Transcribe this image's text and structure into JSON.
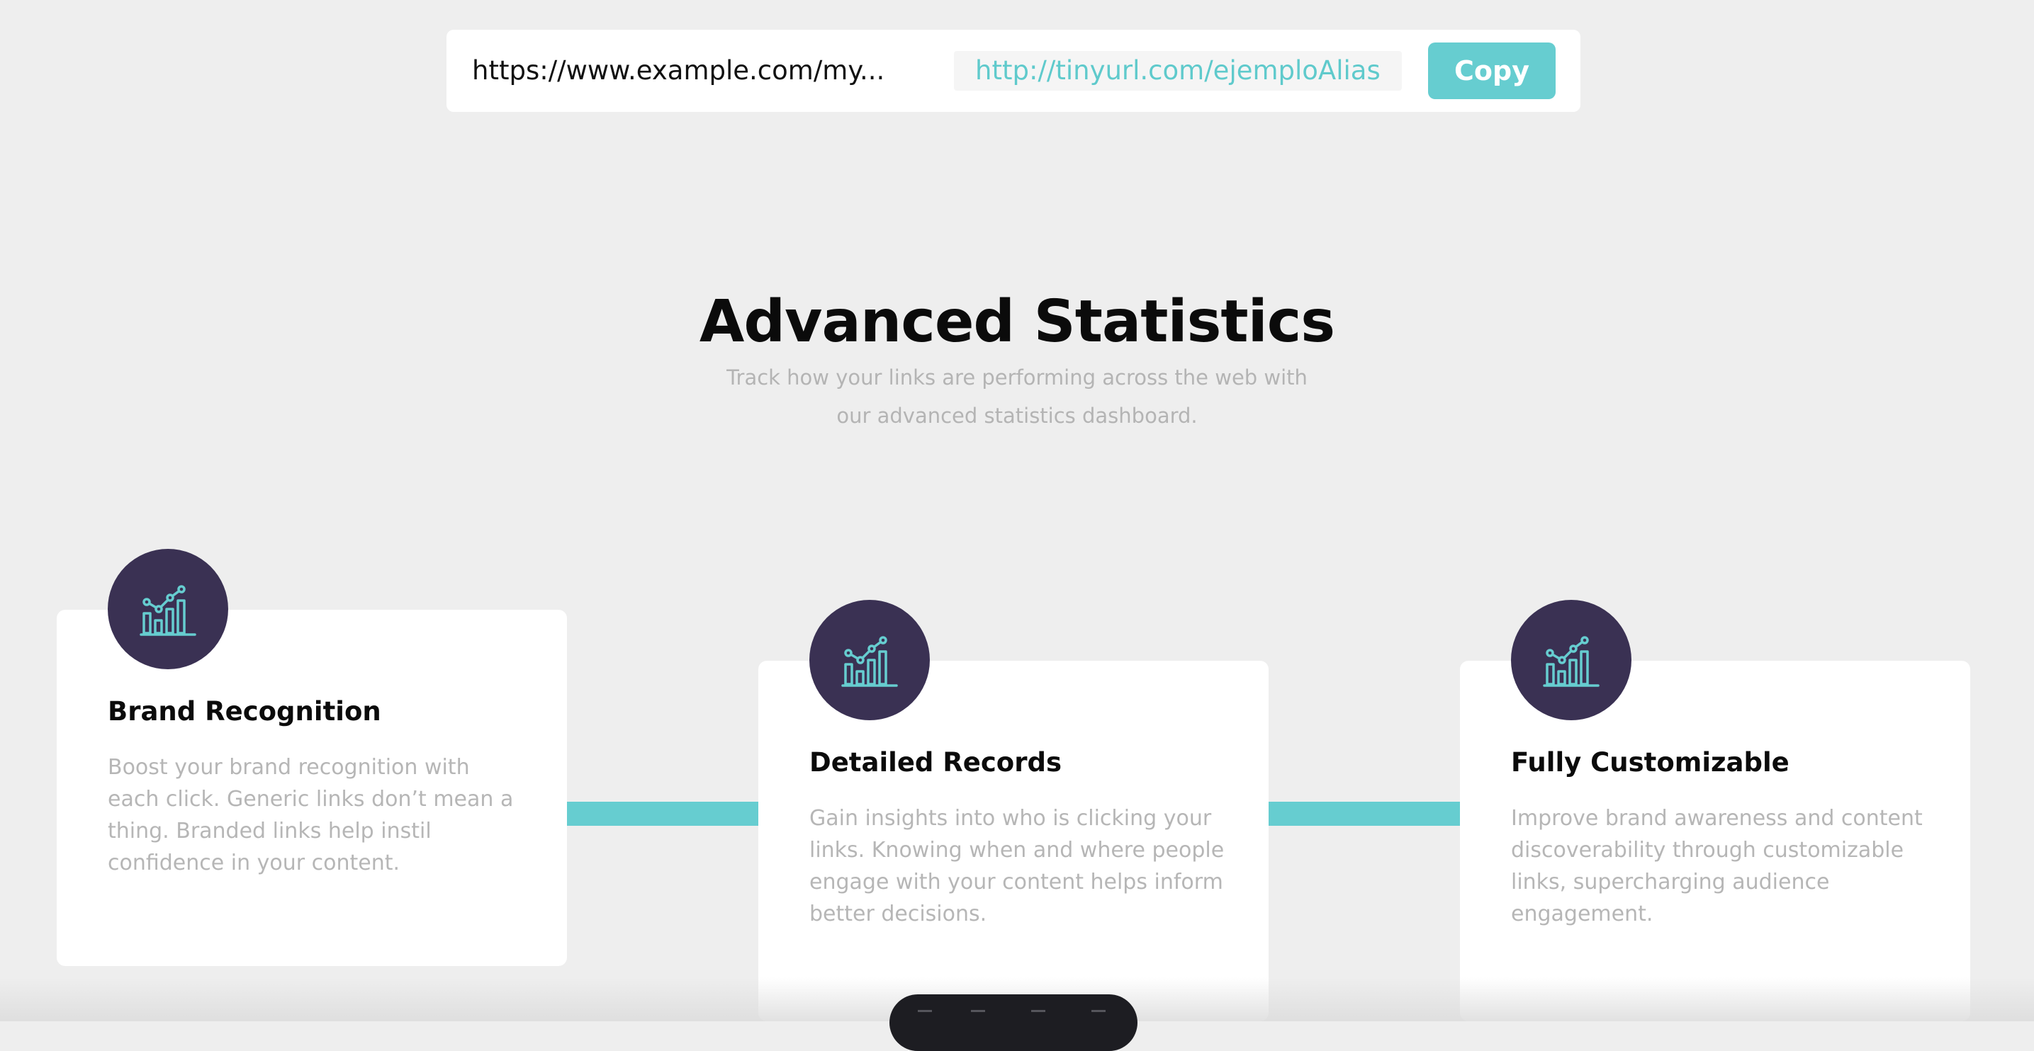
{
  "shortener": {
    "original_url": "https://www.example.com/my...",
    "short_url": "http://tinyurl.com/ejemploAlias",
    "copy_label": "Copy"
  },
  "statistics": {
    "title": "Advanced Statistics",
    "subtitle": "Track how your links are performing across the web with our advanced statistics dashboard."
  },
  "features": [
    {
      "title": "Brand Recognition",
      "description": "Boost your brand recognition with each click. Generic links don’t mean a thing. Branded links help instil confidence in your content.",
      "icon": "chart-icon"
    },
    {
      "title": "Detailed Records",
      "description": "Gain insights into who is clicking your links. Knowing when and where people engage with your content helps inform better decisions.",
      "icon": "chart-icon"
    },
    {
      "title": "Fully Customizable",
      "description": "Improve brand awareness and content discoverability through customizable links, supercharging audience engagement.",
      "icon": "chart-icon"
    }
  ],
  "colors": {
    "accent": "#66cdd0",
    "icon_circle": "#3a3153",
    "background": "#eeeeee",
    "muted_text": "#b6b6b6"
  }
}
